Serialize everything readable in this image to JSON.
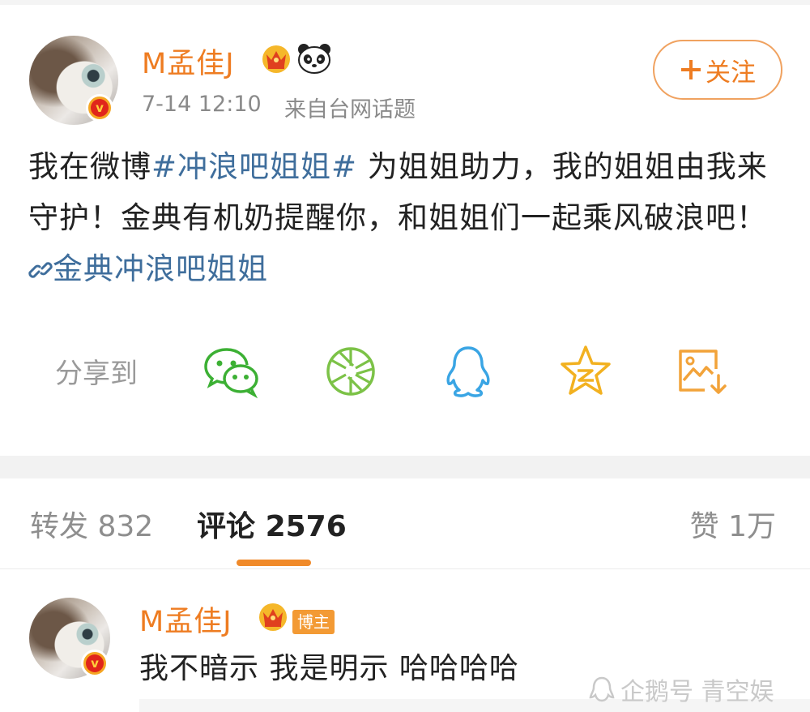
{
  "post": {
    "username": "M孟佳J",
    "time": "7-14 12:10",
    "source": "来自台网话题",
    "follow_label": "关注",
    "text_before": "我在微博",
    "topic": "#冲浪吧姐姐#",
    "text_middle": " 为姐姐助力，我的姐姐由我来守护！金典有机奶提醒你，和姐姐们一起乘风破浪吧！",
    "link_text": "金典冲浪吧姐姐",
    "share_label": "分享到",
    "share_targets": [
      "wechat-icon",
      "moments-icon",
      "qq-icon",
      "qzone-icon",
      "save-image-icon"
    ]
  },
  "tabs": {
    "repost_label": "转发",
    "repost_count": "832",
    "comment_label": "评论",
    "comment_count": "2576",
    "like_label": "赞",
    "like_count": "1万"
  },
  "comment": {
    "username": "M孟佳J",
    "badge": "博主",
    "text": "我不暗示 我是明示 哈哈哈哈"
  },
  "watermark": "企鹅号 青空娱",
  "colors": {
    "accent": "#ee7c21",
    "link": "#3f6e9c",
    "wechat": "#3cb034",
    "qq": "#3aa5e4",
    "star": "#f2b120"
  }
}
